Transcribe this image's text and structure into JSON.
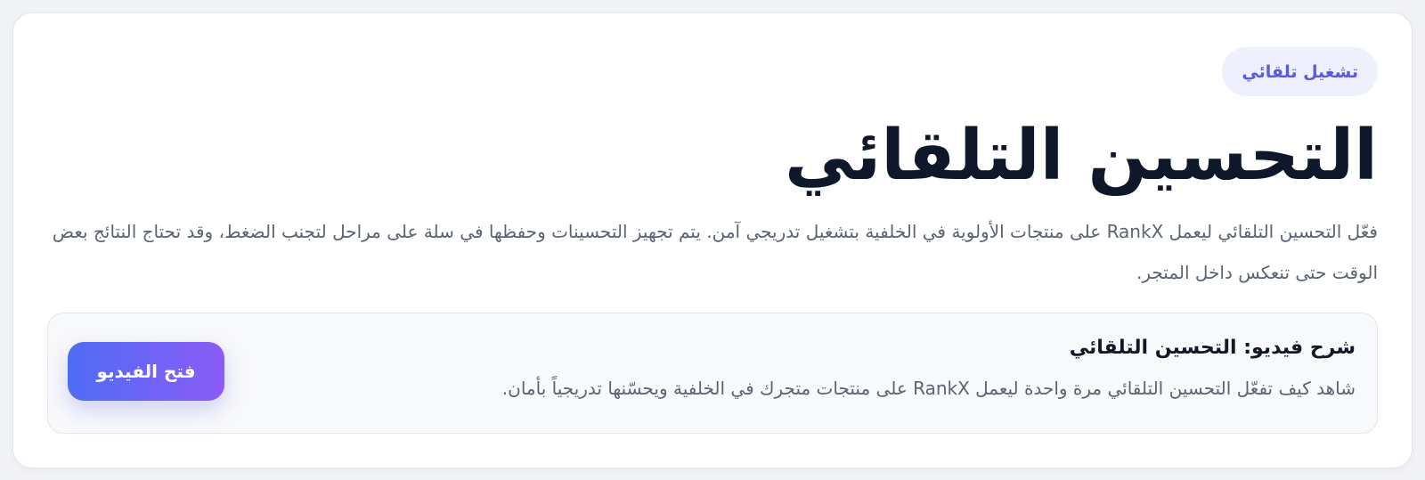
{
  "badge": {
    "label": "تشغيل تلقائي"
  },
  "header": {
    "title": "التحسين التلقائي"
  },
  "description": {
    "text": "فعّل التحسين التلقائي ليعمل RankX على منتجات الأولوية في الخلفية بتشغيل تدريجي آمن. يتم تجهيز التحسينات وحفظها في سلة على مراحل لتجنب الضغط، وقد تحتاج النتائج بعض الوقت حتى تنعكس داخل المتجر."
  },
  "video": {
    "title": "شرح فيديو: التحسين التلقائي",
    "description": "شاهد كيف تفعّل التحسين التلقائي مرة واحدة ليعمل RankX على منتجات متجرك في الخلفية ويحسّنها تدريجياً بأمان.",
    "button_label": "فتح الفيديو"
  },
  "colors": {
    "accent": "#5b5bd6",
    "badge_bg": "#eef0fd",
    "button_gradient_start": "#4f6cf5",
    "button_gradient_end": "#8b5cf6",
    "title": "#0f172a",
    "body_text": "#5b6474"
  }
}
